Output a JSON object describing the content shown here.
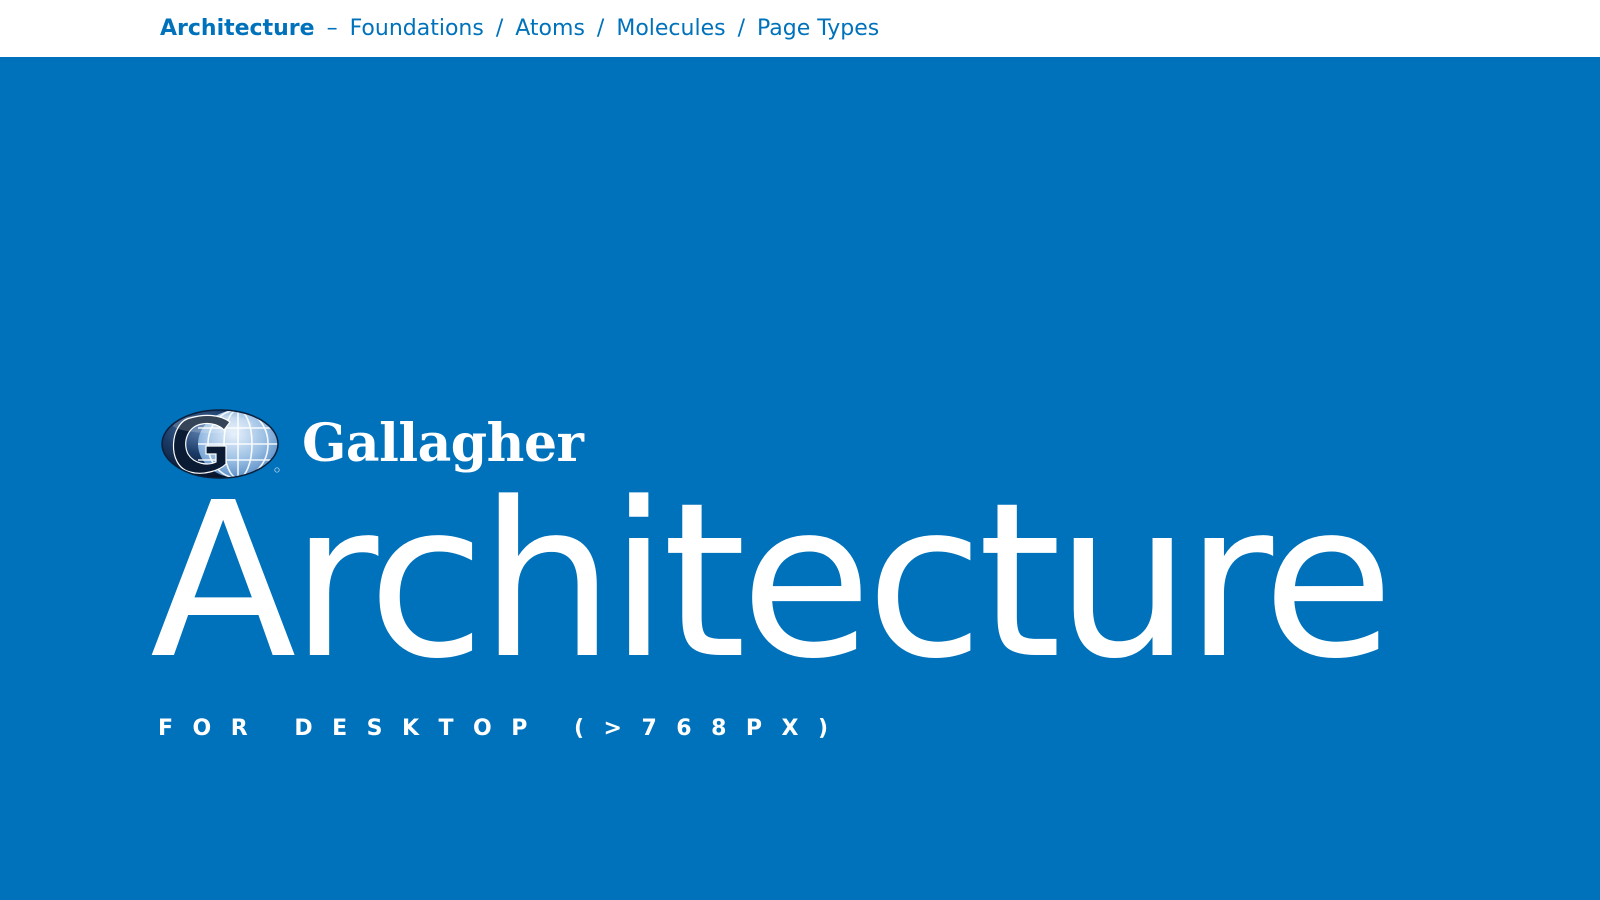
{
  "breadcrumb": {
    "root": "Architecture",
    "dash": "–",
    "items": [
      "Foundations",
      "Atoms",
      "Molecules",
      "Page Types"
    ],
    "separator": "/"
  },
  "brand": {
    "logo_icon": "gallagher-globe-g-icon",
    "wordmark": "Gallagher"
  },
  "hero": {
    "title": "Architecture",
    "subtitle": "FOR DESKTOP (>768PX)"
  },
  "colors": {
    "brand_blue": "#0072bb",
    "text_on_blue": "#ffffff",
    "logo_navy": "#0b1f3a"
  }
}
